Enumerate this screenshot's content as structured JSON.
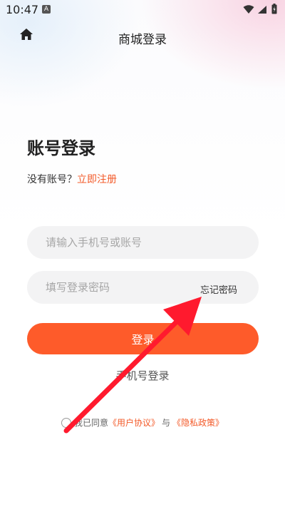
{
  "status_bar": {
    "time": "10:47",
    "notification_glyph": "A",
    "icons": [
      "wifi-icon",
      "signal-icon",
      "battery-icon"
    ]
  },
  "nav": {
    "title": "商城登录",
    "home_icon": "home-icon"
  },
  "login": {
    "title": "账号登录",
    "no_account_text": "没有账号？",
    "register_link": "立即注册",
    "account_placeholder": "请输入手机号或账号",
    "password_placeholder": "填写登录密码",
    "forgot_password": "忘记密码",
    "login_button": "登录",
    "phone_login": "手机号登录"
  },
  "agreement": {
    "prefix": "我已同意",
    "user_agreement": "《用户协议》",
    "conjunction": "与",
    "privacy_policy": "《隐私政策》",
    "checked": false
  },
  "colors": {
    "accent": "#fe5b2a",
    "link": "#f35a29",
    "annotation_arrow": "#ff1a2e",
    "input_bg": "#f3f3f4"
  }
}
